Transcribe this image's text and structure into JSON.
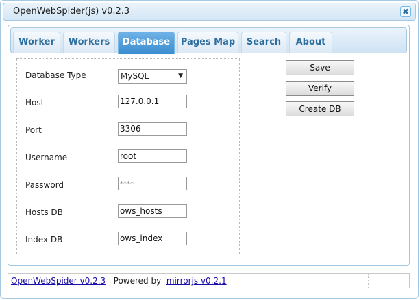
{
  "window": {
    "title": "OpenWebSpider(js) v0.2.3",
    "close_glyph": "✖"
  },
  "tabs": [
    {
      "label": "Worker"
    },
    {
      "label": "Workers"
    },
    {
      "label": "Database"
    },
    {
      "label": "Pages Map"
    },
    {
      "label": "Search"
    },
    {
      "label": "About"
    }
  ],
  "active_tab": "Database",
  "form": {
    "db_type": {
      "label": "Database Type",
      "value": "MySQL",
      "arrow": "▼"
    },
    "host": {
      "label": "Host",
      "value": "127.0.0.1"
    },
    "port": {
      "label": "Port",
      "value": "3306"
    },
    "username": {
      "label": "Username",
      "value": "root"
    },
    "password": {
      "label": "Password",
      "value": "****"
    },
    "hosts_db": {
      "label": "Hosts DB",
      "value": "ows_hosts"
    },
    "index_db": {
      "label": "Index DB",
      "value": "ows_index"
    }
  },
  "buttons": {
    "save": "Save",
    "verify": "Verify",
    "create_db": "Create DB"
  },
  "footer": {
    "app_link": "OpenWebSpider v0.2.3",
    "powered_by": "Powered by",
    "lib_link": "mirrorjs v0.2.1"
  },
  "colors": {
    "accent": "#3a8dd0",
    "tab_text": "#2e6e9e",
    "border": "#a6c9e2"
  }
}
